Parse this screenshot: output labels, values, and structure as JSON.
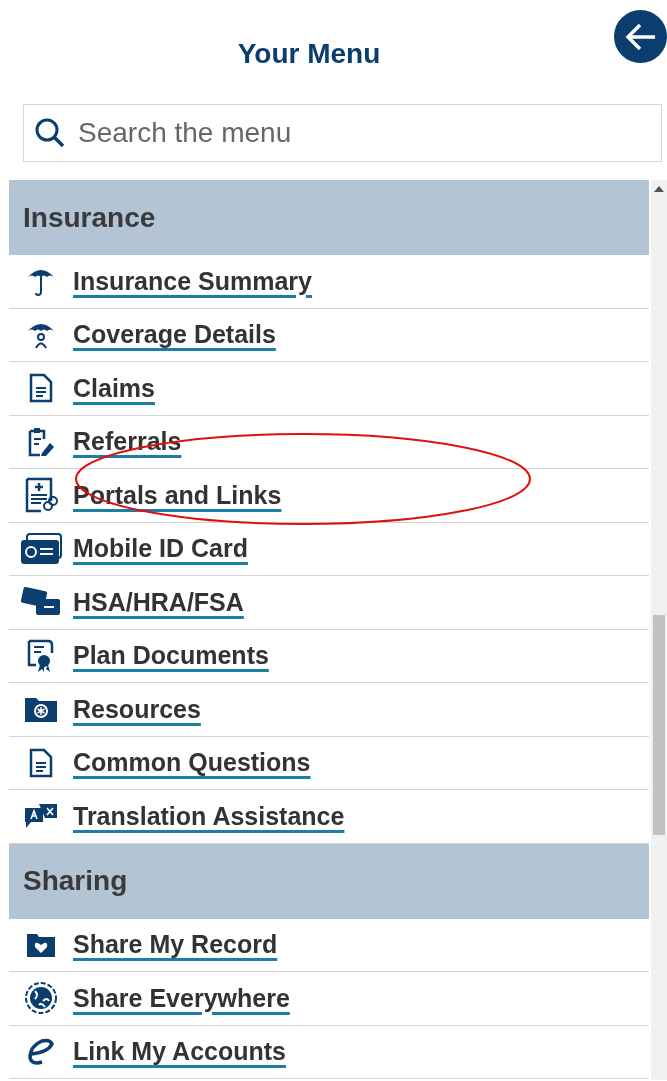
{
  "header": {
    "title": "Your Menu"
  },
  "search": {
    "placeholder": "Search the menu"
  },
  "sections": [
    {
      "title": "Insurance",
      "items": [
        {
          "label": "Insurance Summary",
          "circled": false
        },
        {
          "label": "Coverage Details",
          "circled": false
        },
        {
          "label": "Claims",
          "circled": false
        },
        {
          "label": "Referrals",
          "circled": false
        },
        {
          "label": "Portals and Links",
          "circled": true
        },
        {
          "label": "Mobile ID Card",
          "circled": false
        },
        {
          "label": "HSA/HRA/FSA",
          "circled": false
        },
        {
          "label": "Plan Documents",
          "circled": false
        },
        {
          "label": "Resources",
          "circled": false
        },
        {
          "label": "Common Questions",
          "circled": false
        },
        {
          "label": "Translation Assistance",
          "circled": false
        }
      ]
    },
    {
      "title": "Sharing",
      "items": [
        {
          "label": "Share My Record",
          "circled": false
        },
        {
          "label": "Share Everywhere",
          "circled": false
        },
        {
          "label": "Link My Accounts",
          "circled": false
        }
      ]
    }
  ]
}
